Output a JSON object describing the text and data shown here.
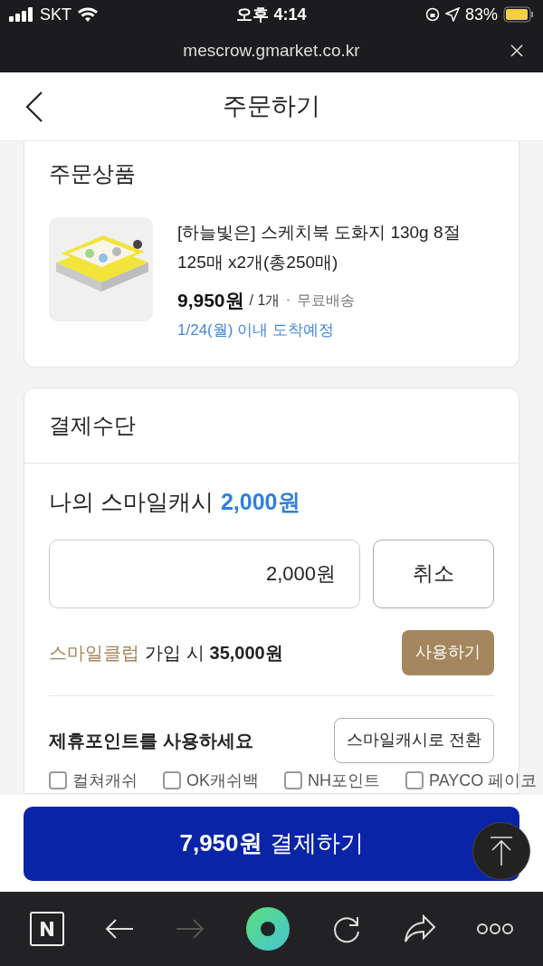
{
  "status_bar": {
    "carrier": "SKT",
    "time": "오후 4:14",
    "battery": "83%"
  },
  "url_bar": {
    "url": "mescrow.gmarket.co.kr"
  },
  "header": {
    "title": "주문하기"
  },
  "order_items": {
    "title": "주문상품",
    "product": {
      "name": "[하늘빛은] 스케치북 도화지 130g 8절 125매 x2개(총250매)",
      "price": "9,950원",
      "quantity": "/ 1개",
      "shipping": "무료배송",
      "delivery": "1/24(월) 이내 도착예정"
    }
  },
  "payment": {
    "title": "결제수단",
    "smile_cash_label": "나의 스마일캐시",
    "smile_cash_amount": "2,000원",
    "amount_field": {
      "value": "2,000원"
    },
    "cancel_button": "취소",
    "club_link": "스마일클럽",
    "club_text": "가입 시",
    "club_amount": "35,000원",
    "use_button": "사용하기",
    "partner_title": "제휴포인트를 사용하세요",
    "convert_button": "스마일캐시로 전환",
    "partners": [
      {
        "label": "컬쳐캐쉬"
      },
      {
        "label": "OK캐쉬백"
      },
      {
        "label": "NH포인트"
      },
      {
        "label": "PAYCO 페이코"
      }
    ]
  },
  "checkout": {
    "amount": "7,950원",
    "label": "결제하기"
  }
}
